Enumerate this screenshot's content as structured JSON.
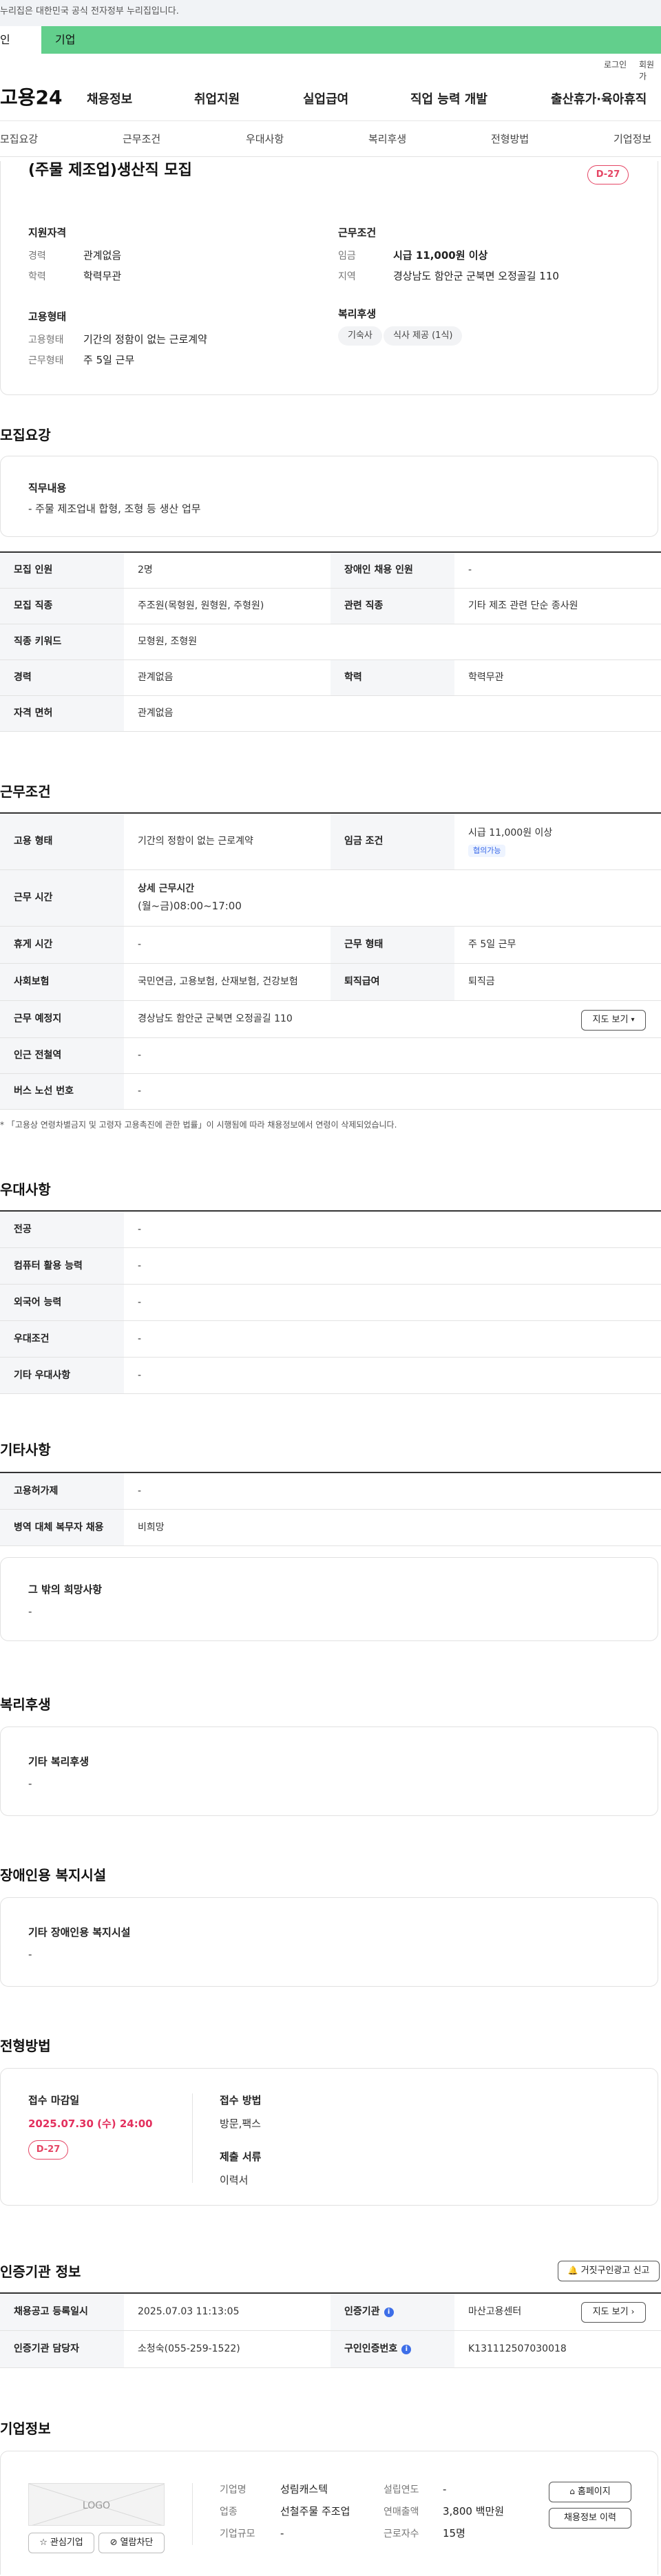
{
  "top": {
    "notice": "누리집은 대한민국 공식 전자정부 누리집입니다.",
    "tabs": [
      "인",
      "기업"
    ],
    "util": [
      "로그인",
      "회원가"
    ],
    "logo": "고용24",
    "gnb": [
      "채용정보",
      "취업지원",
      "실업급여",
      "직업 능력 개발",
      "출산휴가·육아휴직"
    ],
    "anchors": [
      "모집요강",
      "근무조건",
      "우대사항",
      "복리후생",
      "전형방법",
      "기업정보"
    ]
  },
  "summary": {
    "title": "(주물 제조업)생산직 모집",
    "dday": "D-27",
    "qual_head": "지원자격",
    "career_label": "경력",
    "career_value": "관계없음",
    "edu_label": "학력",
    "edu_value": "학력무관",
    "cond_head": "근무조건",
    "wage_label": "임금",
    "wage_value": "시급 11,000원 이상",
    "area_label": "지역",
    "area_value": "경상남도 함안군 군북면 오정골길 110",
    "emp_head": "고용형태",
    "type_label": "고용형태",
    "type_value": "기간의 정함이 없는 근로계약",
    "days_label": "근무형태",
    "days_value": "주 5일 근무",
    "welfare_head": "복리후생",
    "welfare_chips": [
      "기숙사",
      "식사 제공 (1식)"
    ]
  },
  "recruit": {
    "title": "모집요강",
    "job_head": "직무내용",
    "job_value": "- 주물 제조업내 합형, 조형 등 생산 업무",
    "rows": [
      {
        "l1": "모집 인원",
        "v1": "2명",
        "l2": "장애인 채용 인원",
        "v2": "-"
      },
      {
        "l1": "모집 직종",
        "v1": "주조원(목형원, 원형원, 주형원)",
        "l2": "관련 직종",
        "v2": "기타 제조 관련 단순 종사원"
      },
      {
        "l1": "직종 키워드",
        "v1": "모형원, 조형원"
      },
      {
        "l1": "경력",
        "v1": "관계없음",
        "l2": "학력",
        "v2": "학력무관"
      },
      {
        "l1": "자격 면허",
        "v1": "관계없음"
      }
    ]
  },
  "work": {
    "title": "근무조건",
    "type_l": "고용 형태",
    "type_v": "기간의 정함이 없는 근로계약",
    "wage_l": "임금 조건",
    "wage_v": "시급 11,000원 이상",
    "wage_pill": "협의가능",
    "time_l": "근무 시간",
    "time_v1": "상세 근무시간",
    "time_v2": "(월~금)08:00~17:00",
    "rest_l": "휴게 시간",
    "rest_v": "-",
    "shape_l": "근무 형태",
    "shape_v": "주 5일 근무",
    "ins_l": "사회보험",
    "ins_v": "국민연금, 고용보험, 산재보험, 건강보험",
    "ret_l": "퇴직급여",
    "ret_v": "퇴직금",
    "place_l": "근무 예정지",
    "place_v": "경상남도 함안군 군북면 오정골길 110",
    "map_btn": "지도 보기",
    "station_l": "인근 전철역",
    "station_v": "-",
    "bus_l": "버스 노선 번호",
    "bus_v": "-",
    "footnote": "「고용상 연령차별금지 및 고령자 고용촉진에 관한 법률」이 시행됨에 따라 채용정보에서 연령이 삭제되었습니다."
  },
  "pref": {
    "title": "우대사항",
    "rows": [
      {
        "l": "전공",
        "v": "-"
      },
      {
        "l": "컴퓨터 활용 능력",
        "v": "-"
      },
      {
        "l": "외국어 능력",
        "v": "-"
      },
      {
        "l": "우대조건",
        "v": "-"
      },
      {
        "l": "기타 우대사항",
        "v": "-"
      }
    ]
  },
  "etc": {
    "title": "기타사항",
    "rows": [
      {
        "l": "고용허가제",
        "v": "-"
      },
      {
        "l": "병역 대체 복무자 채용",
        "v": "비희망"
      }
    ],
    "hope_head": "그 밖의 희망사항",
    "hope_value": "-"
  },
  "welfare": {
    "title": "복리후생",
    "head": "기타 복리후생",
    "value": "-"
  },
  "disab": {
    "title": "장애인용 복지시설",
    "head": "기타 장애인용 복지시설",
    "value": "-"
  },
  "apply": {
    "title": "전형방법",
    "deadline_l": "접수 마감일",
    "deadline_v": "2025.07.30 (수) 24:00",
    "dday": "D-27",
    "method_l": "접수 방법",
    "method_v": "방문,팩스",
    "docs_l": "제출 서류",
    "docs_v": "이력서"
  },
  "cert": {
    "title": "인증기관 정보",
    "report_btn": "거짓구인광고 신고",
    "reg_l": "채용공고 등록일시",
    "reg_v": "2025.07.03 11:13:05",
    "org_l": "인증기관",
    "org_v": "마산고용센터",
    "map_btn": "지도 보기",
    "mgr_l": "인증기관 담당자",
    "mgr_v": "소청숙(055-259-1522)",
    "num_l": "구인인증번호",
    "num_v": "K131112507030018"
  },
  "corp": {
    "title": "기업정보",
    "logo_text": "LOGO",
    "name_l": "기업명",
    "name_v": "성림캐스텍",
    "ind_l": "업종",
    "ind_v": "선철주물 주조업",
    "size_l": "기업규모",
    "size_v": "-",
    "year_l": "설립연도",
    "year_v": "-",
    "sales_l": "연매출액",
    "sales_v": "3,800 백만원",
    "emp_l": "근로자수",
    "emp_v": "15명",
    "home_btn": "홈페이지",
    "history_btn": "채용정보 이력",
    "fav_btn": "관심기업",
    "block_btn": "열람차단"
  }
}
